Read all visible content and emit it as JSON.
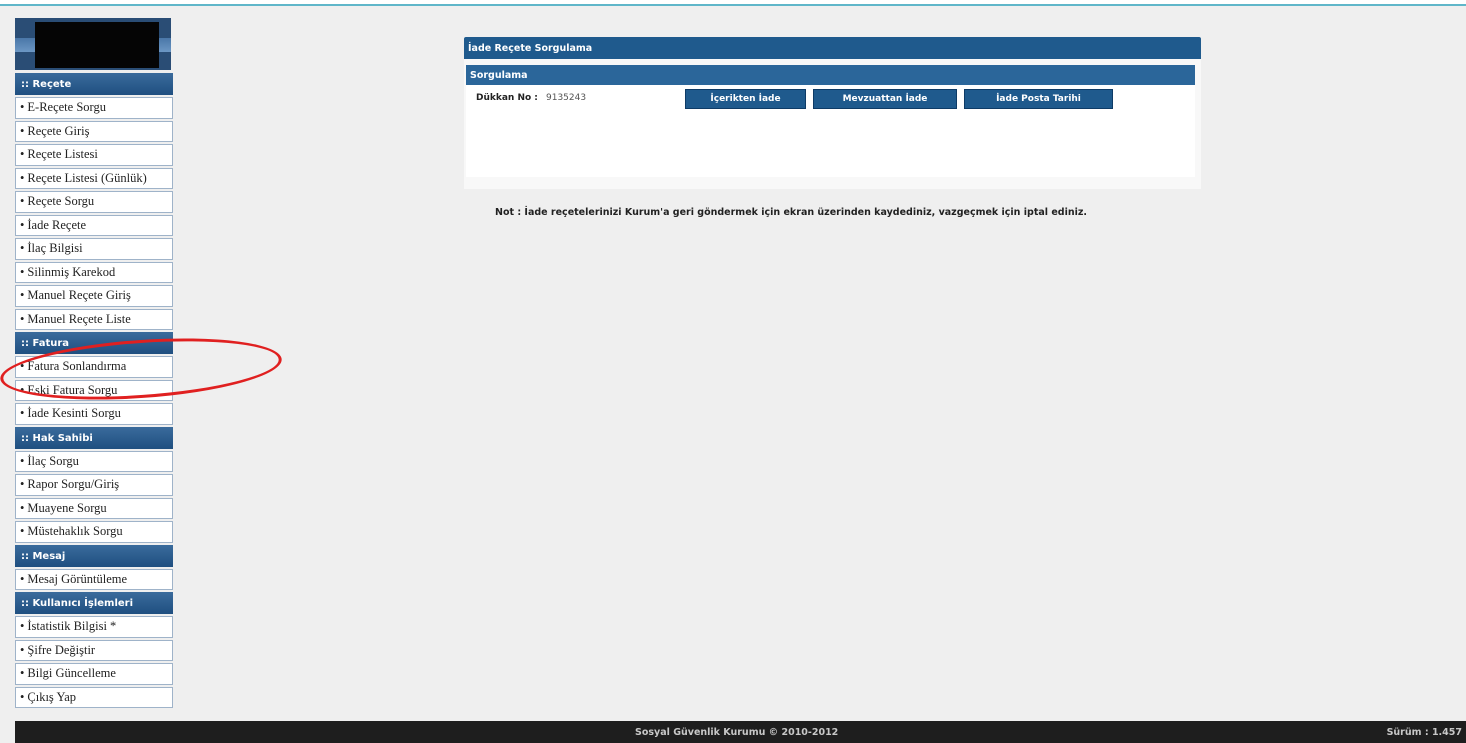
{
  "sidebar": {
    "sections": [
      {
        "title": ":: Reçete",
        "items": [
          "E-Reçete Sorgu",
          "Reçete Giriş",
          "Reçete Listesi",
          "Reçete Listesi (Günlük)",
          "Reçete Sorgu",
          "İade Reçete",
          "İlaç Bilgisi",
          "Silinmiş Karekod",
          "Manuel Reçete Giriş",
          "Manuel Reçete Liste"
        ]
      },
      {
        "title": ":: Fatura",
        "items": [
          "Fatura Sonlandırma",
          "Eski Fatura Sorgu",
          "İade Kesinti Sorgu"
        ]
      },
      {
        "title": ":: Hak Sahibi",
        "items": [
          "İlaç Sorgu",
          "Rapor Sorgu/Giriş",
          "Muayene Sorgu",
          "Müstehaklık Sorgu"
        ]
      },
      {
        "title": ":: Mesaj",
        "items": [
          "Mesaj Görüntüleme"
        ]
      },
      {
        "title": ":: Kullanıcı İşlemleri",
        "items": [
          "İstatistik Bilgisi *",
          "Şifre Değiştir",
          "Bilgi Güncelleme",
          "Çıkış Yap"
        ]
      }
    ],
    "bullet": "•"
  },
  "panel": {
    "title": "İade Reçete Sorgulama",
    "subtitle": "Sorgulama",
    "store_label": "Dükkan No :",
    "store_value": "9135243",
    "buttons": {
      "content_return": "İçerikten İade",
      "regulation_return": "Mevzuattan İade",
      "mail_date": "İade Posta Tarihi"
    }
  },
  "note": "Not : İade reçetelerinizi Kurum'a geri göndermek için ekran üzerinden kaydediniz, vazgeçmek için iptal ediniz.",
  "footer": {
    "copyright": "Sosyal Güvenlik Kurumu © 2010-2012",
    "version": "Sürüm : 1.457"
  },
  "colors": {
    "header_blue": "#1f5a8d",
    "annotation_red": "#e02020",
    "footer_bg": "#1e1e1e"
  }
}
